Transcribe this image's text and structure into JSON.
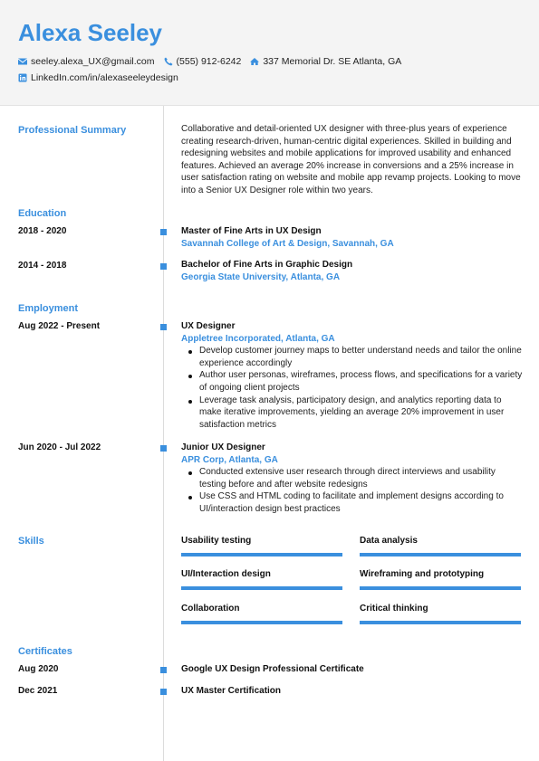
{
  "header": {
    "name": "Alexa Seeley",
    "contacts": [
      {
        "icon": "envelope-icon",
        "text": "seeley.alexa_UX@gmail.com"
      },
      {
        "icon": "phone-icon",
        "text": "(555) 912-6242"
      },
      {
        "icon": "home-icon",
        "text": "337 Memorial Dr. SE Atlanta, GA"
      },
      {
        "icon": "linkedin-icon",
        "text": "LinkedIn.com/in/alexaseeleydesign"
      }
    ]
  },
  "summary": {
    "heading": "Professional Summary",
    "text": "Collaborative and detail-oriented UX designer with three-plus years of experience creating research-driven, human-centric digital experiences. Skilled in building and redesigning websites and mobile applications for improved usability and enhanced features. Achieved an average 20% increase in conversions and a 25% increase in user satisfaction rating on website and mobile app revamp projects. Looking to move into a Senior UX Designer role within two years."
  },
  "education": {
    "heading": "Education",
    "items": [
      {
        "dates": "2018 - 2020",
        "degree": "Master of Fine Arts in UX Design",
        "school": "Savannah College of Art & Design, Savannah, GA"
      },
      {
        "dates": "2014 - 2018",
        "degree": "Bachelor of Fine Arts in Graphic Design",
        "school": "Georgia State University, Atlanta, GA"
      }
    ]
  },
  "employment": {
    "heading": "Employment",
    "items": [
      {
        "dates": "Aug 2022 - Present",
        "title": "UX Designer",
        "company": "Appletree Incorporated, Atlanta, GA",
        "bullets": [
          "Develop customer journey maps to better understand needs and tailor the online experience accordingly",
          "Author user personas, wireframes, process flows, and specifications for a variety of ongoing client projects",
          "Leverage task analysis, participatory design, and analytics reporting data to make iterative improvements, yielding an average 20% improvement in user satisfaction metrics"
        ]
      },
      {
        "dates": "Jun 2020 - Jul 2022",
        "title": "Junior UX Designer",
        "company": "APR Corp, Atlanta, GA",
        "bullets": [
          "Conducted extensive user research through direct interviews and usability testing before and after website redesigns",
          "Use CSS and HTML coding to facilitate and implement designs according to UI/interaction design best practices"
        ]
      }
    ]
  },
  "skills": {
    "heading": "Skills",
    "items": [
      {
        "name": "Usability testing",
        "level": 1.0
      },
      {
        "name": "Data analysis",
        "level": 1.0
      },
      {
        "name": "UI/Interaction design",
        "level": 1.0
      },
      {
        "name": "Wireframing and prototyping",
        "level": 1.0
      },
      {
        "name": "Collaboration",
        "level": 1.0
      },
      {
        "name": "Critical thinking",
        "level": 1.0
      }
    ]
  },
  "certificates": {
    "heading": "Certificates",
    "items": [
      {
        "date": "Aug 2020",
        "name": "Google UX Design Professional Certificate"
      },
      {
        "date": "Dec 2021",
        "name": "UX Master Certification"
      }
    ]
  },
  "colors": {
    "accent": "#3a8fde",
    "header_bg": "#f4f4f4",
    "text": "#1a1a1a"
  }
}
